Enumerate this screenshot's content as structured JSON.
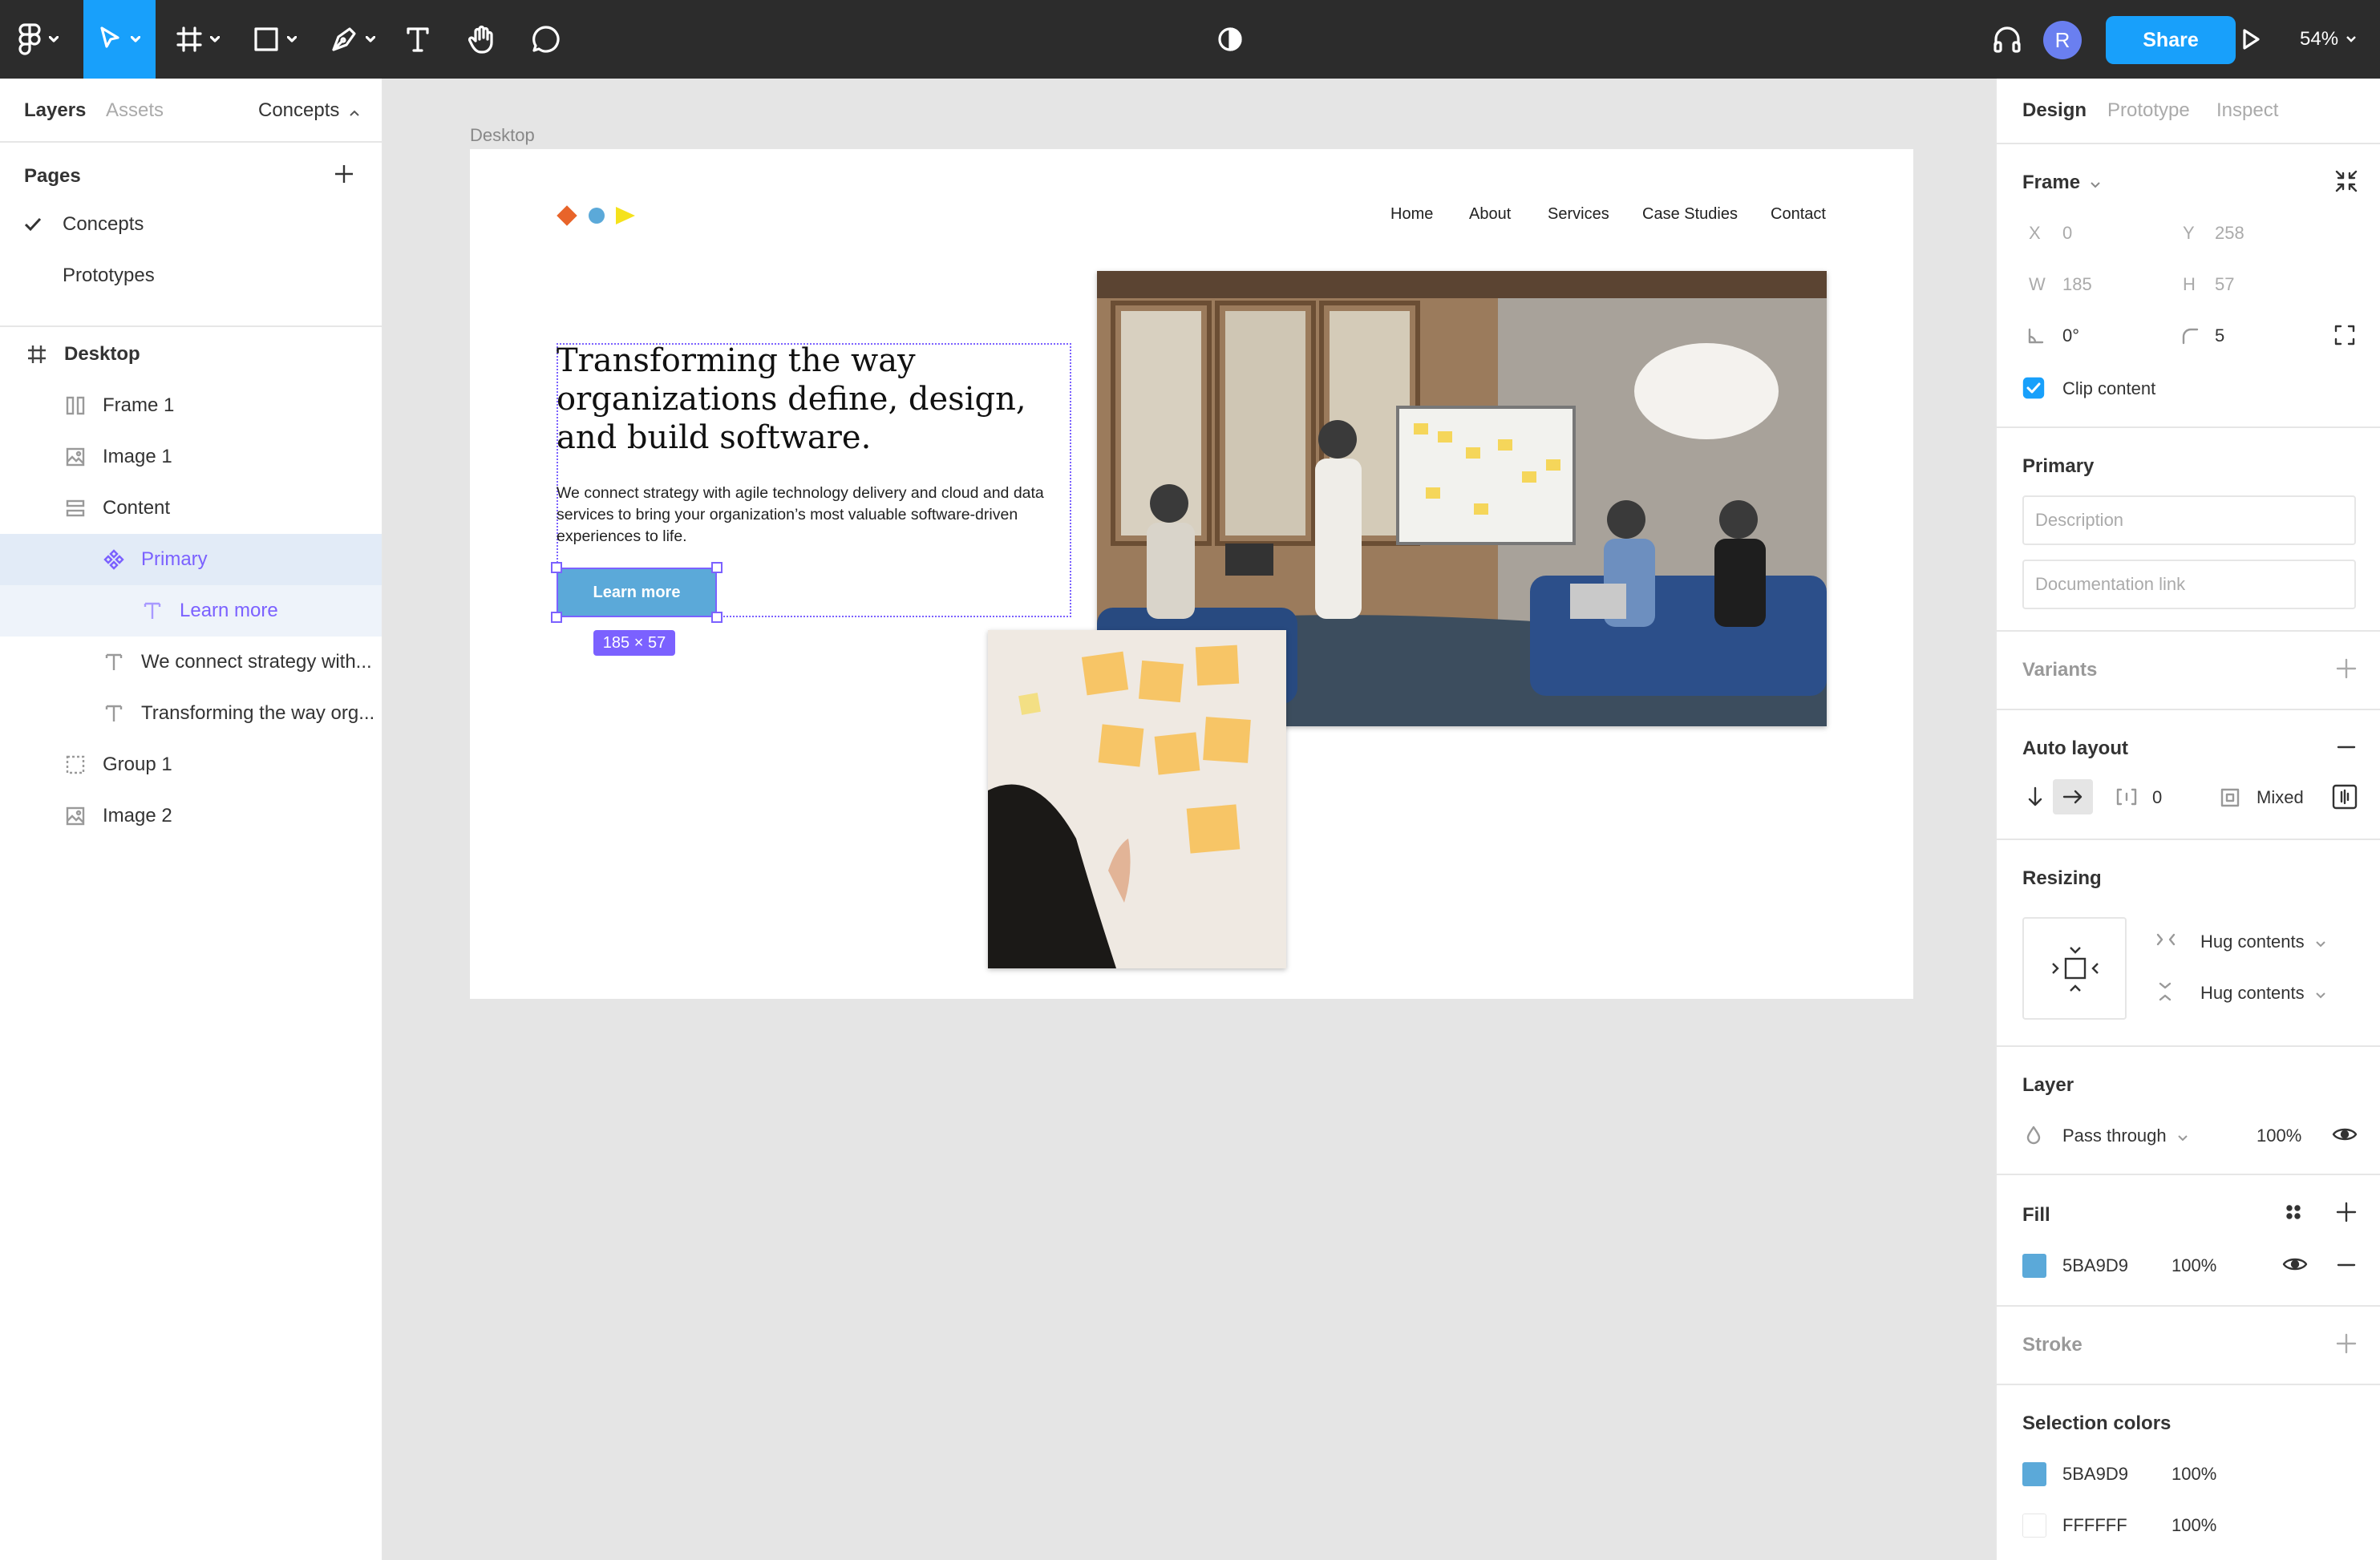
{
  "toolbar": {
    "share_label": "Share",
    "avatar_initial": "R",
    "zoom": "54%"
  },
  "left_panel": {
    "tabs": {
      "layers": "Layers",
      "assets": "Assets",
      "page_switcher": "Concepts"
    },
    "pages_title": "Pages",
    "pages": [
      {
        "label": "Concepts",
        "checked": true
      },
      {
        "label": "Prototypes",
        "checked": false
      }
    ],
    "layers": [
      {
        "label": "Desktop",
        "icon": "frame-hash-icon"
      },
      {
        "label": "Frame 1",
        "icon": "columns-icon"
      },
      {
        "label": "Image 1",
        "icon": "image-icon"
      },
      {
        "label": "Content",
        "icon": "rows-icon"
      },
      {
        "label": "Primary",
        "icon": "component-instance-icon"
      },
      {
        "label": "Learn more",
        "icon": "text-icon"
      },
      {
        "label": "We connect strategy with...",
        "icon": "text-icon"
      },
      {
        "label": "Transforming the way org...",
        "icon": "text-icon"
      },
      {
        "label": "Group 1",
        "icon": "group-icon"
      },
      {
        "label": "Image 2",
        "icon": "image-icon"
      }
    ]
  },
  "canvas": {
    "frame_label": "Desktop",
    "nav": [
      "Home",
      "About",
      "Services",
      "Case Studies",
      "Contact"
    ],
    "hero_title": "Transforming the way organizations define, design, and build software.",
    "hero_body": "We connect strategy with agile technology delivery and cloud and data services to bring your organization’s most valuable software-driven experiences to life.",
    "button_label": "Learn more",
    "size_badge": "185 × 57",
    "logo_colors": [
      "#e8642a",
      "#5ba9d9",
      "#f5e21c"
    ]
  },
  "right_panel": {
    "tabs": {
      "design": "Design",
      "prototype": "Prototype",
      "inspect": "Inspect"
    },
    "frame": {
      "title": "Frame",
      "x_label": "X",
      "x": "0",
      "y_label": "Y",
      "y": "258",
      "w_label": "W",
      "w": "185",
      "h_label": "H",
      "h": "57",
      "rotation": "0°",
      "radius": "5",
      "clip_content": "Clip content"
    },
    "component": {
      "title": "Primary",
      "description_placeholder": "Description",
      "doc_link_placeholder": "Documentation link"
    },
    "variants_title": "Variants",
    "auto_layout": {
      "title": "Auto layout",
      "spacing": "0",
      "padding": "Mixed"
    },
    "resizing": {
      "title": "Resizing",
      "horizontal": "Hug contents",
      "vertical": "Hug contents"
    },
    "layer": {
      "title": "Layer",
      "blend": "Pass through",
      "opacity": "100%"
    },
    "fill": {
      "title": "Fill",
      "hex": "5BA9D9",
      "opacity": "100%",
      "color": "#5ba9d9"
    },
    "stroke_title": "Stroke",
    "selection_colors": {
      "title": "Selection colors",
      "items": [
        {
          "hex": "5BA9D9",
          "opacity": "100%",
          "color": "#5ba9d9"
        },
        {
          "hex": "FFFFFF",
          "opacity": "100%",
          "color": "#ffffff"
        }
      ]
    }
  }
}
